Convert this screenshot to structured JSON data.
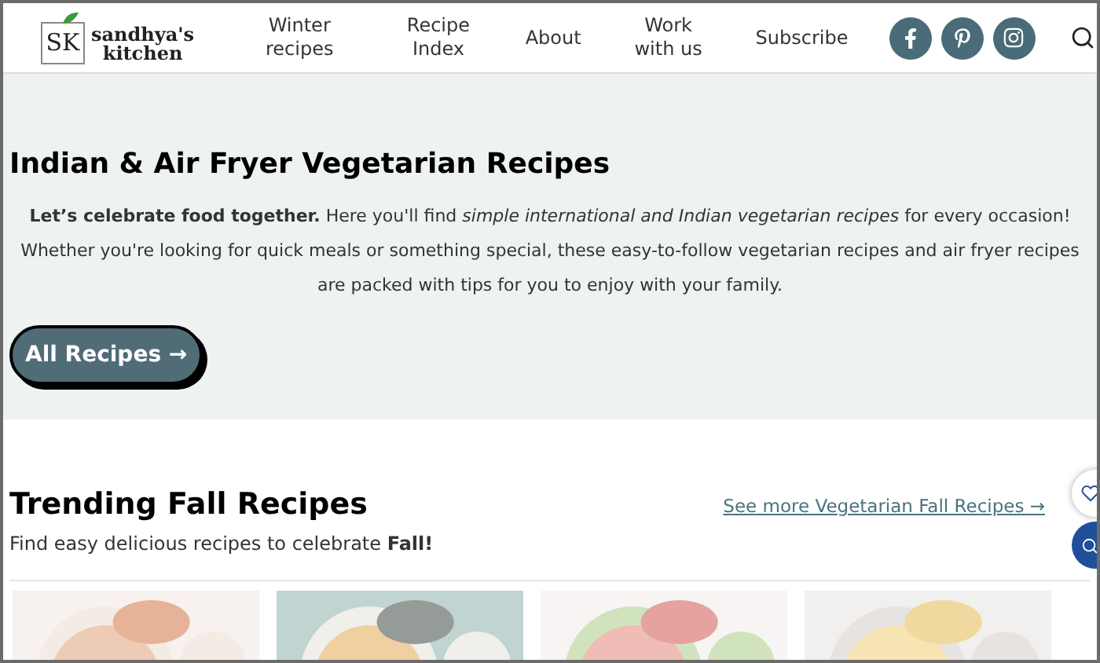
{
  "header": {
    "logo": {
      "initials": "SK",
      "name_lines": [
        "sandhya's",
        "kitchen"
      ]
    },
    "nav": [
      "Winter recipes",
      "Recipe Index",
      "About",
      "Work with us",
      "Subscribe"
    ],
    "social": [
      {
        "kind": "facebook"
      },
      {
        "kind": "pinterest"
      },
      {
        "kind": "instagram"
      }
    ]
  },
  "hero": {
    "title": "Indian & Air Fryer Vegetarian Recipes",
    "text": "**Let’s celebrate food together.** Here you'll find *simple international and Indian vegetarian recipes* for every occasion! Whether you're looking for quick meals or something special, these easy-to-follow vegetarian recipes and air fryer recipes are packed with tips for you to enjoy with your family.",
    "button": "All Recipes →"
  },
  "trending": {
    "title": "Trending Fall Recipes",
    "subtitle": "Find easy delicious recipes to celebrate **Fall!**",
    "link": "See more Vegetarian Fall Recipes →"
  }
}
